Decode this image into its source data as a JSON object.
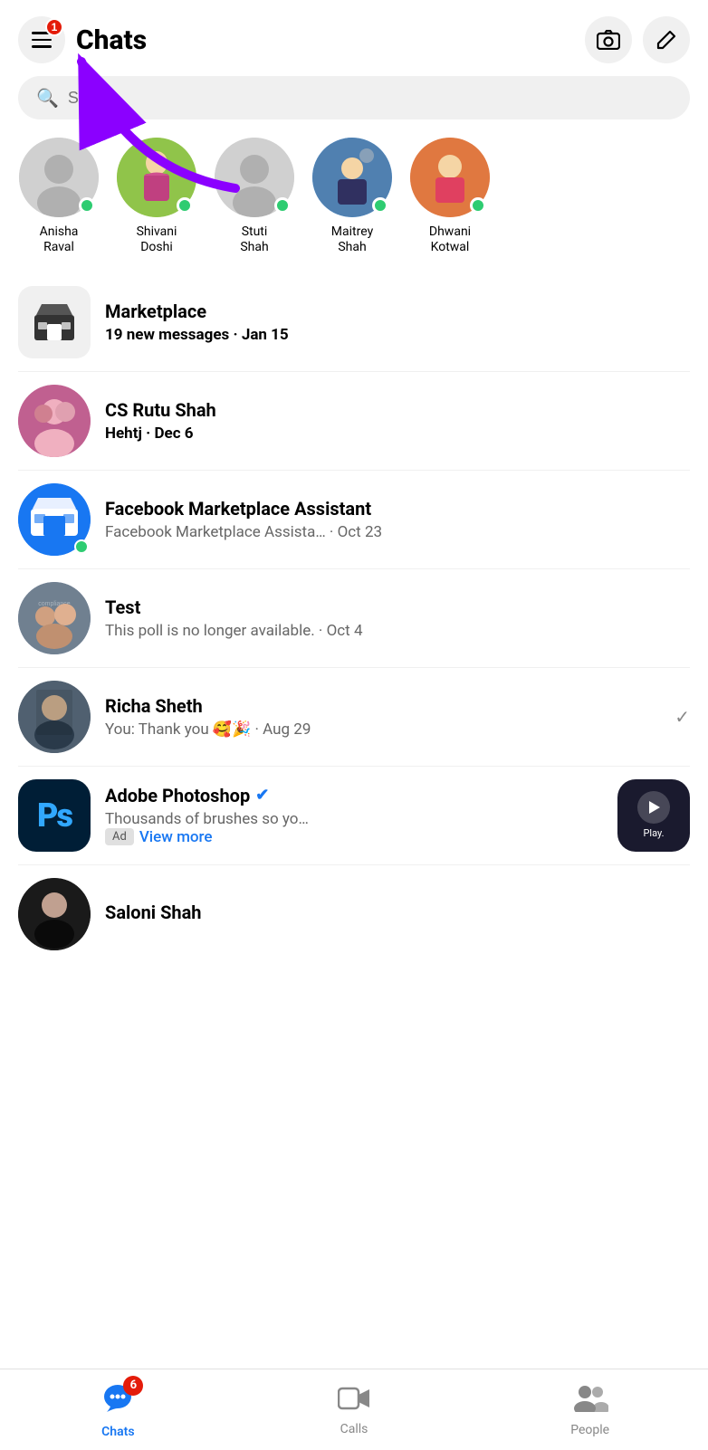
{
  "header": {
    "title": "Chats",
    "notification_count": "1",
    "camera_btn_label": "Camera",
    "compose_btn_label": "Compose"
  },
  "search": {
    "placeholder": "Search"
  },
  "contacts": [
    {
      "id": "anisha",
      "name": "Anisha\nRaval",
      "online": true,
      "has_image": false
    },
    {
      "id": "shivani",
      "name": "Shivani\nDoshi",
      "online": true,
      "has_image": true
    },
    {
      "id": "stuti",
      "name": "Stuti\nShah",
      "online": true,
      "has_image": false
    },
    {
      "id": "maitrey",
      "name": "Maitrey\nShah",
      "online": true,
      "has_image": true
    },
    {
      "id": "dhwani",
      "name": "Dhwani\nKotwal",
      "online": true,
      "has_image": true
    }
  ],
  "chats": [
    {
      "id": "marketplace",
      "name": "Marketplace",
      "preview": "19 new messages",
      "date": "Jan 15",
      "type": "marketplace",
      "bold": true
    },
    {
      "id": "cs-rutu-shah",
      "name": "CS Rutu Shah",
      "preview": "Hehtj",
      "date": "Dec 6",
      "type": "contact",
      "bold": true
    },
    {
      "id": "fb-marketplace-assistant",
      "name": "Facebook Marketplace Assistant",
      "preview": "Facebook Marketplace Assista…",
      "date": "Oct 23",
      "type": "fb-marketplace",
      "online": true,
      "bold": false
    },
    {
      "id": "test",
      "name": "Test",
      "preview": "This poll is no longer available.",
      "date": "Oct 4",
      "type": "contact",
      "bold": false
    },
    {
      "id": "richa-sheth",
      "name": "Richa Sheth",
      "preview": "You: Thank you 🥰🎉",
      "date": "Aug 29",
      "type": "contact",
      "read": true,
      "bold": false
    },
    {
      "id": "adobe-photoshop",
      "name": "Adobe Photoshop",
      "preview": "Thousands of brushes so yo…",
      "date": "",
      "type": "ad",
      "verified": true,
      "ad_label": "Ad",
      "ad_link_text": "View more",
      "bold": false
    },
    {
      "id": "saloni-shah",
      "name": "Saloni Shah",
      "preview": "",
      "date": "",
      "type": "contact",
      "bold": false
    }
  ],
  "bottom_nav": {
    "chats": {
      "label": "Chats",
      "badge": "6",
      "active": true
    },
    "calls": {
      "label": "Calls",
      "active": false
    },
    "people": {
      "label": "People",
      "active": false
    }
  },
  "arrow_annotation": {
    "visible": true
  }
}
